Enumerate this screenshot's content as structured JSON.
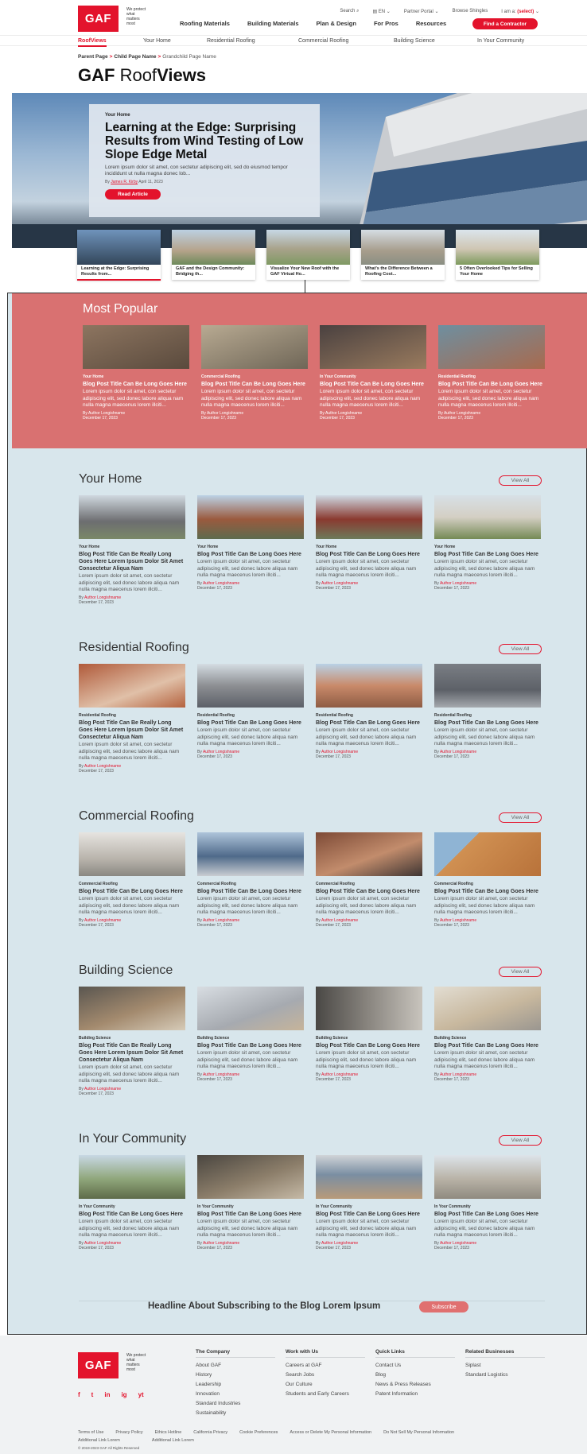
{
  "brand": {
    "logo": "GAF",
    "tagline": "We protect what matters most",
    "title_light": "Roof",
    "title_bold": "Views",
    "title_prefix": "GAF"
  },
  "utility": {
    "search": "Search",
    "lang": "EN",
    "partner": "Partner Portal",
    "browse": "Browse Shingles",
    "iam": "I am a:",
    "iam_value": "(select)"
  },
  "main_nav": [
    "Roofing Materials",
    "Building Materials",
    "Plan & Design",
    "For Pros",
    "Resources"
  ],
  "contractor_button": "Find a Contractor",
  "sub_nav": {
    "active": "RoofViews",
    "items": [
      "Your Home",
      "Residential Roofing",
      "Commercial Roofing",
      "Building Science",
      "In Your Community"
    ]
  },
  "breadcrumb": [
    "Parent Page",
    "Child Page Name",
    "Grandchild Page Name"
  ],
  "hero": {
    "eyebrow": "Your Home",
    "title": "Learning at the Edge: Surprising Results from Wind Testing of Low Slope Edge Metal",
    "excerpt": "Lorem ipsum dolor sit amet, con sectetur adipiscing elit, sed do eiusmod tempor incididunt ut nulla magna donec lob...",
    "by": "By",
    "author": "James R. Kirby",
    "date": "April 11, 2023",
    "button": "Read Article"
  },
  "thumbs": [
    "Learning at the Edge: Surprising Results from...",
    "GAF and the Design Community: Bridging th...",
    "Visualize Your New Roof with the GAF Virtual Ho...",
    "What's the Difference Between a Roofing Cost...",
    "5 Often Overlooked Tips for Selling Your Home"
  ],
  "common": {
    "view_all": "View All",
    "title_short": "Blog Post Title Can Be Long Goes Here",
    "title_long": "Blog Post Title Can Be Really Long Goes Here Lorem Ipsum Dolor Sit Amet Consectetur Aliqua Nam",
    "desc": "Lorem ipsum dolor sit amet, con sectetur adipiscing elit, sed donec labore aliqua nam nulla magna maecenus lorem illciti...",
    "by": "By",
    "author": "Author Longishname",
    "date": "December 17, 2023"
  },
  "sections": {
    "popular": {
      "title": "Most Popular",
      "cats": [
        "Your Home",
        "Commercial Roofing",
        "In Your Community",
        "Residential Roofing"
      ]
    },
    "home": {
      "title": "Your Home",
      "cat": "Your Home"
    },
    "residential": {
      "title": "Residential Roofing",
      "cat": "Residential Roofing"
    },
    "commercial": {
      "title": "Commercial Roofing",
      "cat": "Commercial Roofing"
    },
    "science": {
      "title": "Building Science",
      "cat": "Building Science"
    },
    "community": {
      "title": "In Your Community",
      "cat": "In Your Community"
    }
  },
  "subscribe": {
    "text": "Headline About Subscribing to the Blog Lorem Ipsum",
    "button": "Subscribe"
  },
  "footer": {
    "social": [
      "f",
      "t",
      "in",
      "ig",
      "yt"
    ],
    "cols": [
      {
        "heading": "The Company",
        "links": [
          "About GAF",
          "History",
          "Leadership",
          "Innovation",
          "Standard Industries",
          "Sustainability"
        ]
      },
      {
        "heading": "Work with Us",
        "links": [
          "Careers at GAF",
          "Search Jobs",
          "Our Culture",
          "Students and Early Careers"
        ]
      },
      {
        "heading": "Quick Links",
        "links": [
          "Contact Us",
          "Blog",
          "News & Press Releases",
          "Patent Information"
        ]
      },
      {
        "heading": "Related Businesses",
        "links": [
          "Siplast",
          "Standard Logistics"
        ]
      }
    ],
    "legal": [
      "Terms of Use",
      "Privacy Policy",
      "Ethics Hotline",
      "California Privacy",
      "Cookie Preferences",
      "Access or Delete My Personal Information",
      "Do Not Sell My Personal Information"
    ],
    "legal2": [
      "Additional Link Lorem",
      "Additional Link Lorem"
    ],
    "copyright": "© 2019-2023 GAF All Rights Reserved"
  }
}
